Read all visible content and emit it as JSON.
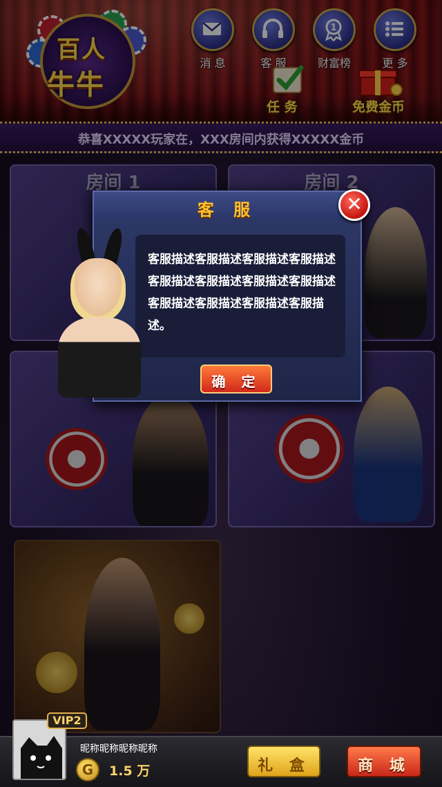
{
  "logo": {
    "line1": "百人",
    "line2": "牛牛"
  },
  "nav": [
    {
      "label": "消 息",
      "icon": "mail-icon"
    },
    {
      "label": "客 服",
      "icon": "headset-icon"
    },
    {
      "label": "财富榜",
      "icon": "medal-icon"
    },
    {
      "label": "更 多",
      "icon": "menu-list-icon"
    }
  ],
  "actions": {
    "task": "任 务",
    "free_coins": "免费金币"
  },
  "ticker": "恭喜XXXXX玩家在，XXX房间内获得XXXXX金币",
  "rooms": [
    {
      "title": "房间 1"
    },
    {
      "title": "房间 2"
    }
  ],
  "dialog": {
    "title": "客 服",
    "body": "客服描述客服描述客服描述客服描述客服描述客服描述客服描述客服描述客服描述客服描述客服描述客服描述。",
    "ok_label": "确 定",
    "close_icon": "close-icon"
  },
  "user": {
    "vip": "VIP2",
    "nickname": "昵称昵称昵称昵称",
    "coin_symbol": "G",
    "coins": "1.5 万"
  },
  "bottom": {
    "gift_label": "礼 盒",
    "shop_label": "商 城"
  },
  "colors": {
    "accent_gold": "#ffc02a",
    "dialog_bg": "#1e2547",
    "ok_button": "#d2281a"
  }
}
